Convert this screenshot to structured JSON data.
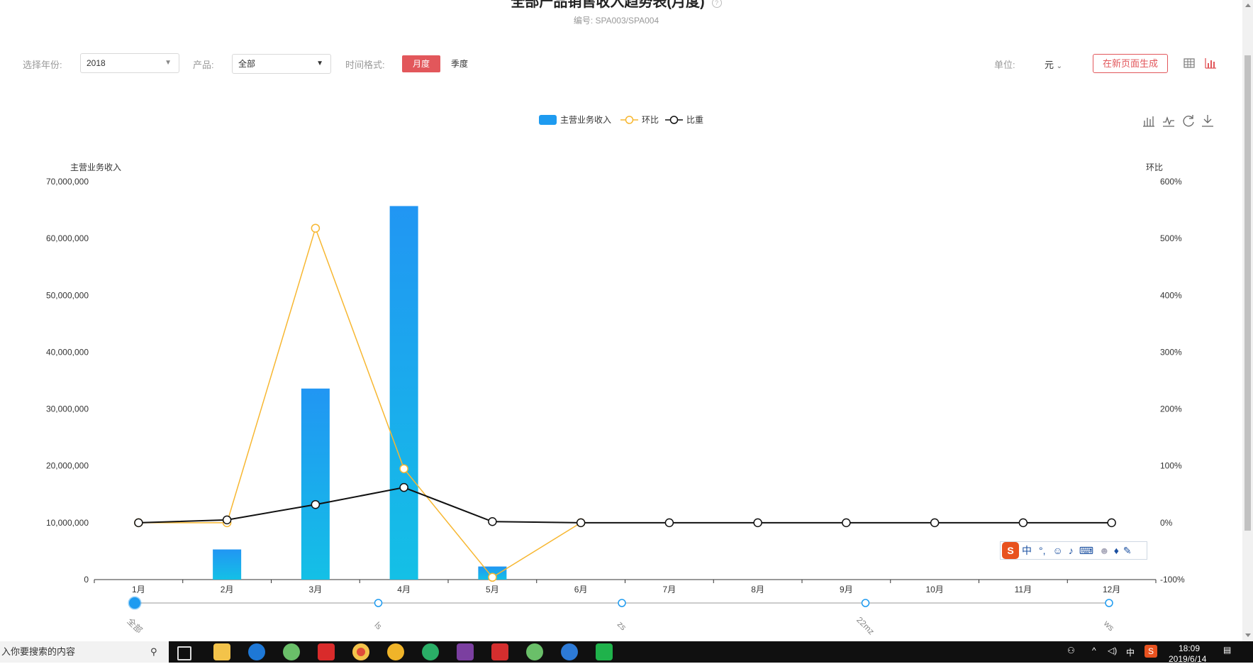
{
  "header": {
    "title": "全部产品销售收入趋势表(月度)",
    "subtitle": "编号: SPA003/SPA004"
  },
  "filters": {
    "year_label": "选择年份:",
    "year_value": "2018",
    "product_label": "产品:",
    "product_value": "全部",
    "time_format_label": "时间格式:",
    "time_format_options": [
      "月度",
      "季度"
    ],
    "time_format_selected": "月度",
    "unit_label": "单位:",
    "unit_value": "元",
    "generate_button": "在新页面生成"
  },
  "chart_data": {
    "type": "bar",
    "title": "",
    "categories": [
      "1月",
      "2月",
      "3月",
      "4月",
      "5月",
      "6月",
      "7月",
      "8月",
      "9月",
      "10月",
      "11月",
      "12月"
    ],
    "ylabel_left": "主营业务收入",
    "ylabel_right": "环比",
    "ylim_left": [
      0,
      70000000
    ],
    "ylim_right": [
      -100,
      600
    ],
    "yticks_left": [
      "0",
      "10,000,000",
      "20,000,000",
      "30,000,000",
      "40,000,000",
      "50,000,000",
      "60,000,000",
      "70,000,000"
    ],
    "yticks_right": [
      "-100%",
      "0%",
      "100%",
      "200%",
      "300%",
      "400%",
      "500%",
      "600%"
    ],
    "legend_position": "top-center",
    "grid": false,
    "series": [
      {
        "name": "主营业务收入",
        "type": "bar",
        "axis": "left",
        "color": "#1e9bf0",
        "values": [
          0,
          5300000,
          33600000,
          65700000,
          2300000,
          0,
          0,
          0,
          0,
          0,
          0,
          0
        ]
      },
      {
        "name": "环比",
        "type": "line",
        "axis": "right",
        "color": "#f7b731",
        "values": [
          0,
          0,
          518,
          95,
          -96,
          0,
          null,
          null,
          null,
          null,
          null,
          null
        ]
      },
      {
        "name": "比重",
        "type": "line",
        "axis": "right",
        "color": "#111111",
        "values": [
          0,
          5,
          32,
          62,
          2,
          0,
          0,
          0,
          0,
          0,
          0,
          0
        ]
      }
    ],
    "timeline": {
      "labels": [
        "全部",
        "ls",
        "zs",
        "22mz",
        "ws"
      ],
      "selected": "全部",
      "color": "#1e9bf0"
    }
  },
  "toolbox": [
    "bar-chart-icon",
    "line-chart-icon",
    "restore-icon",
    "download-icon"
  ],
  "view_toggle": [
    "table-view-icon",
    "chart-view-icon"
  ],
  "ime": {
    "lang": "中"
  },
  "taskbar": {
    "search_placeholder": "入你要搜索的内容",
    "tray_lang": "中",
    "clock_time": "18:09",
    "clock_date": "2019/6/14"
  }
}
